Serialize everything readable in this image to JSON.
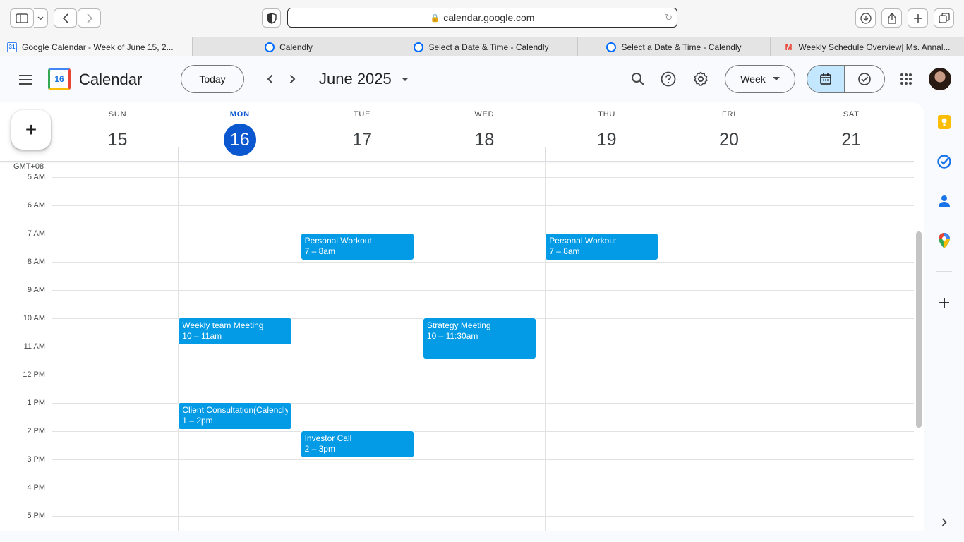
{
  "browser": {
    "address": "calendar.google.com",
    "tabs": [
      {
        "label": "Google Calendar - Week of June 15, 2...",
        "favicon": "google-calendar-icon",
        "active": true
      },
      {
        "label": "Calendly",
        "favicon": "calendly-icon",
        "active": false
      },
      {
        "label": "Select a Date & Time - Calendly",
        "favicon": "calendly-icon",
        "active": false
      },
      {
        "label": "Select a Date & Time - Calendly",
        "favicon": "calendly-icon",
        "active": false
      },
      {
        "label": "Weekly Schedule Overview| Ms. Annal...",
        "favicon": "gmail-icon",
        "active": false
      }
    ]
  },
  "header": {
    "logo_day": "16",
    "title": "Calendar",
    "today_label": "Today",
    "month_label": "June 2025",
    "view_label": "Week"
  },
  "timezone": "GMT+08",
  "days": [
    {
      "dow": "SUN",
      "num": "15",
      "today": false
    },
    {
      "dow": "MON",
      "num": "16",
      "today": true
    },
    {
      "dow": "TUE",
      "num": "17",
      "today": false
    },
    {
      "dow": "WED",
      "num": "18",
      "today": false
    },
    {
      "dow": "THU",
      "num": "19",
      "today": false
    },
    {
      "dow": "FRI",
      "num": "20",
      "today": false
    },
    {
      "dow": "SAT",
      "num": "21",
      "today": false
    }
  ],
  "hours": [
    "5 AM",
    "6 AM",
    "7 AM",
    "8 AM",
    "9 AM",
    "10 AM",
    "11 AM",
    "12 PM",
    "1 PM",
    "2 PM",
    "3 PM",
    "4 PM",
    "5 PM"
  ],
  "first_hour": 5,
  "events": [
    {
      "title": "Personal Workout",
      "time": "7 – 8am",
      "day": 2,
      "start": 7,
      "end": 8
    },
    {
      "title": "Personal Workout",
      "time": "7 – 8am",
      "day": 4,
      "start": 7,
      "end": 8
    },
    {
      "title": "Weekly team Meeting",
      "time": "10 – 11am",
      "day": 1,
      "start": 10,
      "end": 11
    },
    {
      "title": "Strategy Meeting",
      "time": "10 – 11:30am",
      "day": 3,
      "start": 10,
      "end": 11.5
    },
    {
      "title": "Client Consultation(Calendly)",
      "time": "1 – 2pm",
      "day": 1,
      "start": 13,
      "end": 14
    },
    {
      "title": "Investor Call",
      "time": "2 – 3pm",
      "day": 2,
      "start": 14,
      "end": 15
    }
  ],
  "colors": {
    "event": "#039be5",
    "today": "#0b57d0",
    "selected_view": "#c2e7ff"
  },
  "side_icons": [
    "keep-icon",
    "tasks-icon",
    "contacts-icon",
    "maps-icon"
  ]
}
